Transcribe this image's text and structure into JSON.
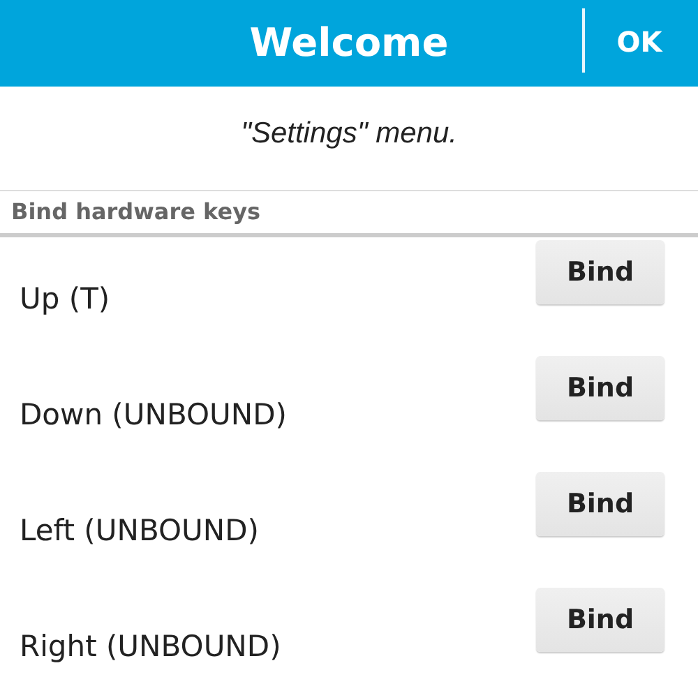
{
  "title_bar": {
    "title": "Welcome",
    "ok_button": "OK"
  },
  "note": "\"Settings\" menu.",
  "section_header": "Bind hardware keys",
  "keys": [
    {
      "label": "Up (T)",
      "button": "Bind"
    },
    {
      "label": "Down (UNBOUND)",
      "button": "Bind"
    },
    {
      "label": "Left (UNBOUND)",
      "button": "Bind"
    },
    {
      "label": "Right (UNBOUND)",
      "button": "Bind"
    }
  ]
}
